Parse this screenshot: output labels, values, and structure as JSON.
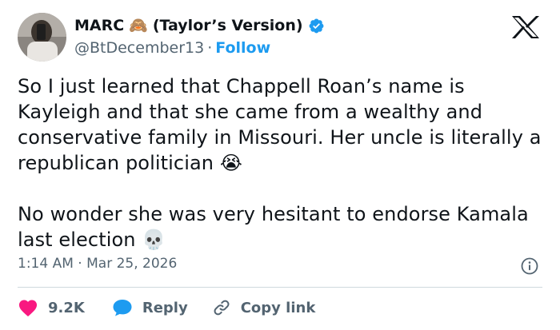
{
  "author": {
    "display_name": "MARC",
    "name_emoji": "🙈",
    "name_suffix": "(Taylor’s Version)",
    "verified_icon": "verified-badge-icon",
    "handle": "@BtDecember13",
    "separator": "·",
    "follow_label": "Follow"
  },
  "brand": {
    "logo_icon": "x-logo-icon"
  },
  "tweet": {
    "paragraph1": "So I just learned that Chappell Roan’s name is Kayleigh and that she came from a wealthy and conservative family in Missouri. Her uncle is literally a republican politician",
    "paragraph1_emoji": "😭",
    "paragraph2": "No wonder she was very hesitant to endorse Kamala last election",
    "paragraph2_emoji": "💀"
  },
  "meta": {
    "time": "1:14 AM",
    "separator": "·",
    "date": "Mar 25, 2026",
    "info_icon": "info-icon"
  },
  "actions": {
    "like_count": "9.2K",
    "reply_label": "Reply",
    "copy_link_label": "Copy link"
  },
  "colors": {
    "accent": "#1d9bf0",
    "like": "#f91880",
    "text": "#0f1419",
    "secondary": "#536471",
    "divider": "#cfd9de"
  }
}
